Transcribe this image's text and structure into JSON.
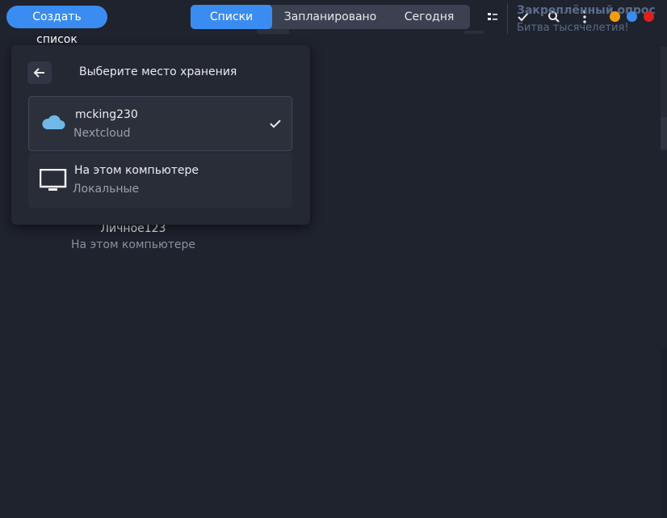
{
  "header": {
    "create_button": "Создать список",
    "tabs": [
      {
        "label": "Списки",
        "active": true
      },
      {
        "label": "Запланировано",
        "active": false
      },
      {
        "label": "Сегодня",
        "active": false
      }
    ],
    "icons": [
      "list-view-icon",
      "check-icon",
      "search-icon",
      "more-vert-icon"
    ],
    "window_controls": {
      "minimize_color": "#f39c12",
      "maximize_color": "#3b8cf0",
      "close_color": "#e0201c"
    }
  },
  "background": {
    "right_panel": {
      "title": "Закреплённый опрос",
      "subtitle": "Битва тысячелетия!"
    },
    "list_item": {
      "name": "Личное123",
      "location": "На этом компьютере"
    }
  },
  "storage_popup": {
    "title": "Выберите место хранения",
    "options": [
      {
        "name": "mcking230",
        "type": "Nextcloud",
        "icon": "cloud-icon",
        "selected": true
      },
      {
        "name": "На этом компьютере",
        "type": "Локальные",
        "icon": "monitor-icon",
        "selected": false
      }
    ]
  },
  "colors": {
    "accent": "#3b8cf0",
    "background": "#1f232e",
    "popup": "#232833"
  }
}
